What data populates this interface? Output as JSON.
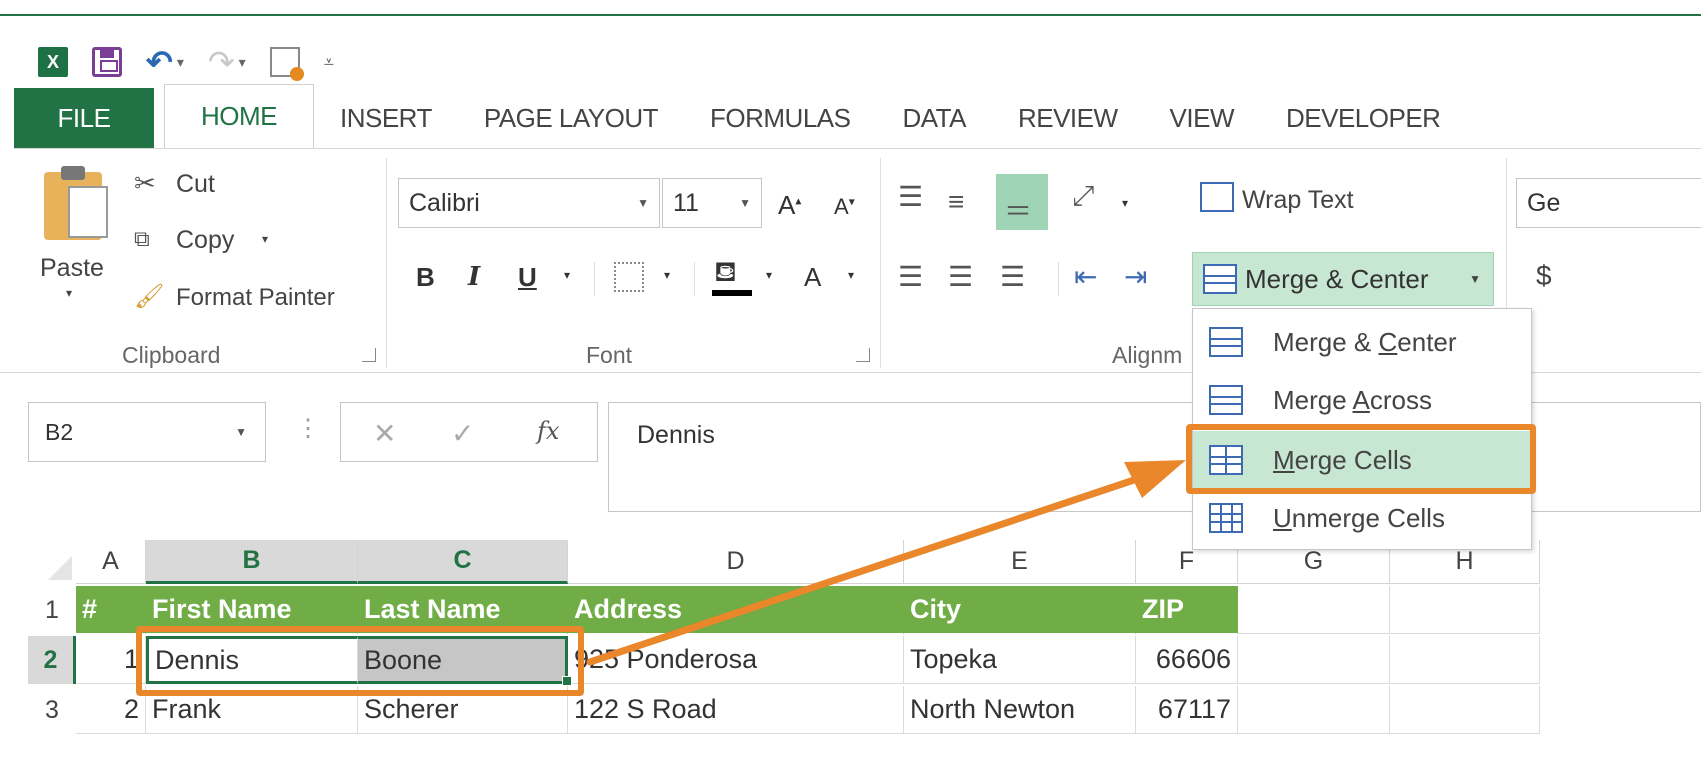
{
  "app": {
    "icon_letter": "X"
  },
  "tabs": [
    "FILE",
    "HOME",
    "INSERT",
    "PAGE LAYOUT",
    "FORMULAS",
    "DATA",
    "REVIEW",
    "VIEW",
    "DEVELOPER"
  ],
  "clipboard": {
    "paste": "Paste",
    "cut": "Cut",
    "copy": "Copy",
    "format_painter": "Format Painter",
    "group": "Clipboard"
  },
  "font": {
    "name": "Calibri",
    "size": "11",
    "bold": "B",
    "italic": "I",
    "underline": "U",
    "grow": "A",
    "shrink": "A",
    "color_a": "A",
    "group": "Font"
  },
  "alignment": {
    "wrap": "Wrap Text",
    "merge": "Merge & Center",
    "group": "Alignm"
  },
  "number": {
    "format_partial": "Ge",
    "currency": "$"
  },
  "merge_menu": {
    "items": [
      {
        "label_pre": "Merge & ",
        "label_u": "C",
        "label_post": "enter"
      },
      {
        "label_pre": "Merge ",
        "label_u": "A",
        "label_post": "cross"
      },
      {
        "label_pre": "",
        "label_u": "M",
        "label_post": "erge Cells"
      },
      {
        "label_pre": "",
        "label_u": "U",
        "label_post": "nmerge Cells"
      }
    ]
  },
  "formula_bar": {
    "name_box": "B2",
    "cancel": "✕",
    "enter": "✓",
    "fx": "fx",
    "content": "Dennis"
  },
  "columns": [
    "A",
    "B",
    "C",
    "D",
    "E",
    "F",
    "G",
    "H"
  ],
  "rows": [
    "1",
    "2",
    "3"
  ],
  "sheet": {
    "header": [
      "#",
      "First Name",
      "Last Name",
      "Address",
      "City",
      "ZIP"
    ],
    "data": [
      [
        "1",
        "Dennis",
        "Boone",
        "925 Ponderosa",
        "Topeka",
        "66606"
      ],
      [
        "2",
        "Frank",
        "Scherer",
        "122 S Road",
        "North Newton",
        "67117"
      ]
    ]
  },
  "colors": {
    "excel_green": "#217346",
    "table_header": "#70ad47",
    "highlight": "#e9872a",
    "merge_hover": "#c7e7d3"
  }
}
